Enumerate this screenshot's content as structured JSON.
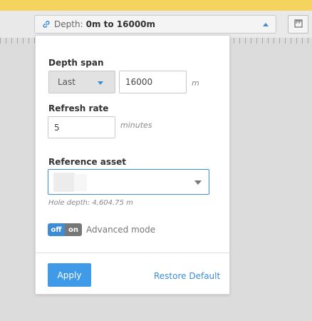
{
  "toolbar": {
    "depth_label": "Depth:",
    "depth_value": "0m to 16000m"
  },
  "panel": {
    "depth_span": {
      "label": "Depth span",
      "mode": "Last",
      "value": "16000",
      "unit": "m"
    },
    "refresh_rate": {
      "label": "Refresh rate",
      "value": "5",
      "unit": "minutes"
    },
    "reference_asset": {
      "label": "Reference asset",
      "hint": "Hole depth: 4,604.75 m"
    },
    "advanced_mode": {
      "off_label": "off",
      "on_label": "on",
      "label": "Advanced mode",
      "state": "off"
    },
    "apply_label": "Apply",
    "restore_label": "Restore Default"
  },
  "colors": {
    "accent": "#3c8dd6",
    "top_strip": "#f4d35e"
  },
  "icons": [
    "link-icon",
    "chevron-up-icon",
    "ruler-icon",
    "chevron-down-icon"
  ]
}
